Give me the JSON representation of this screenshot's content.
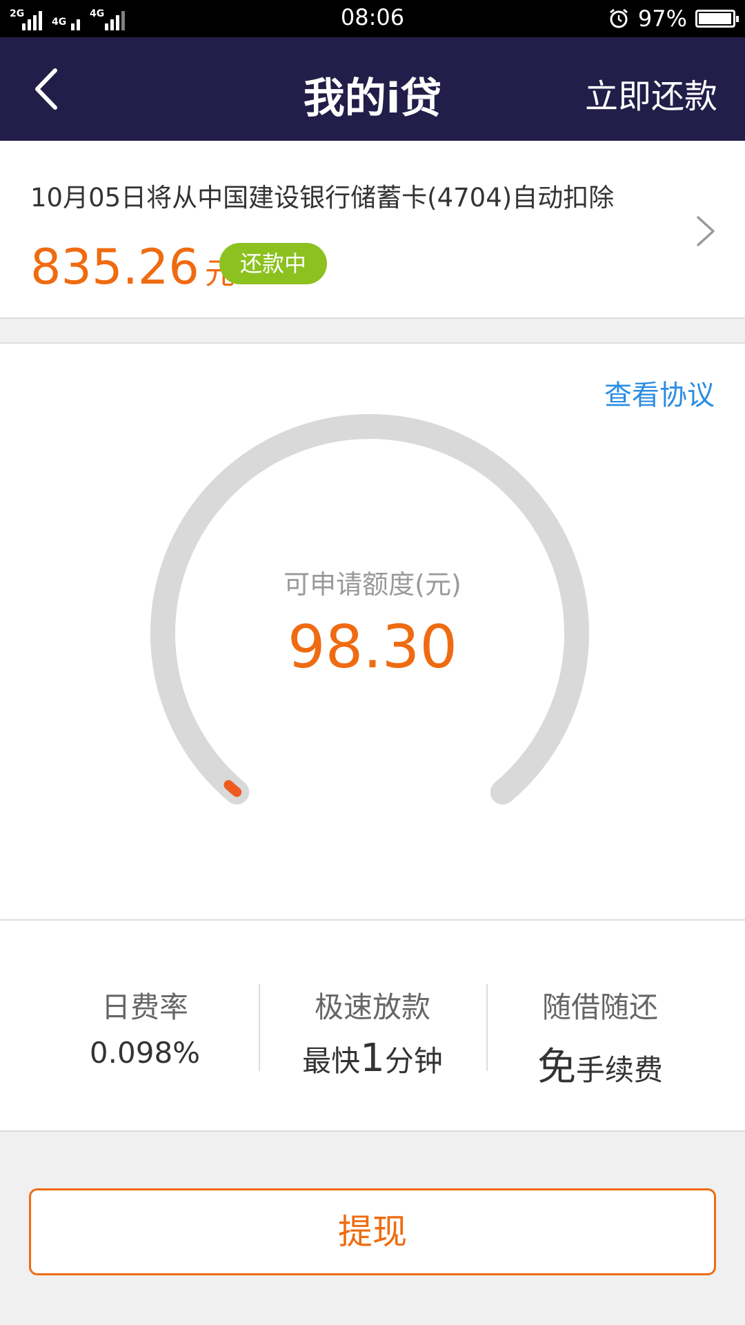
{
  "status_bar": {
    "signal_1": "2G",
    "signal_2": "4G",
    "signal_3": "4G",
    "time": "08:06",
    "battery_percent": "97%",
    "battery_level": 0.97,
    "icons": [
      "signal-icon",
      "alarm-icon",
      "battery-icon"
    ]
  },
  "navbar": {
    "back_icon": "chevron-left-icon",
    "title": "我的i贷",
    "action": "立即还款"
  },
  "repayment": {
    "description": "10月05日将从中国建设银行储蓄卡(4704)自动扣除",
    "amount": "835.26",
    "unit": "元",
    "status": "还款中",
    "arrow_icon": "chevron-right-icon"
  },
  "credit": {
    "view_agreement": "查看协议",
    "label": "可申请额度(元)",
    "value": "98.30",
    "gauge_fill_fraction": 0.0
  },
  "features": [
    {
      "title": "日费率",
      "value": "0.098%"
    },
    {
      "title": "极速放款",
      "value_prefix": "最快",
      "value_big": "1",
      "value_suffix": "分钟"
    },
    {
      "title": "随借随还",
      "value_big": "免",
      "value_suffix": "手续费"
    }
  ],
  "withdraw_button": "提现",
  "colors": {
    "navbar_bg": "#221e49",
    "accent_orange": "#ef6b11",
    "badge_green": "#8cc11f",
    "link_blue": "#2a8de2",
    "gauge_track": "#d9d9d9"
  }
}
